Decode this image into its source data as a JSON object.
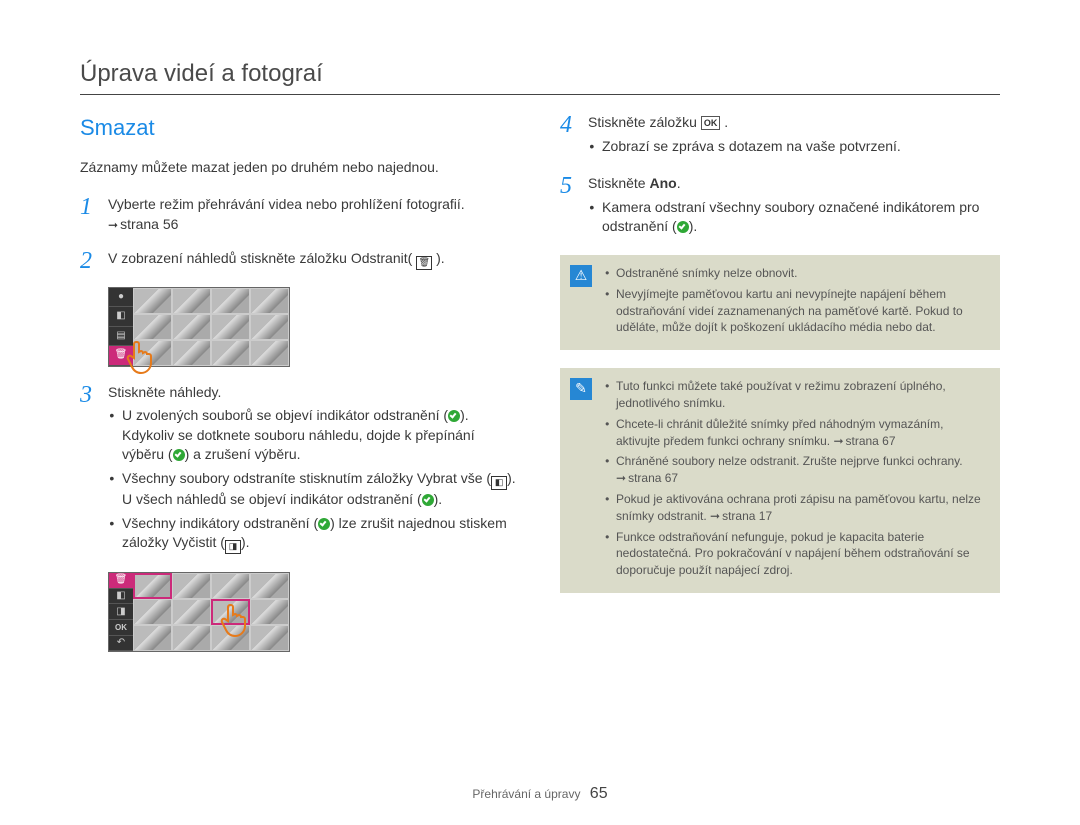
{
  "header": {
    "title": "Úprava videí a fotograí"
  },
  "section": {
    "title": "Smazat"
  },
  "intro": "Záznamy můžete mazat jeden po druhém nebo najednou.",
  "steps": {
    "s1": {
      "num": "1",
      "text": "Vyberte režim přehrávání videa nebo prohlížení fotografií.",
      "ref": "strana 56"
    },
    "s2": {
      "num": "2",
      "text_a": "V zobrazení náhledů stiskněte záložku Odstranit(",
      "text_b": ")."
    },
    "s3": {
      "num": "3",
      "text": "Stiskněte náhledy.",
      "b1a": "U zvolených souborů se objeví indikátor odstranění (",
      "b1b": "). Kdykoliv se dotknete souboru náhledu, dojde k přepínání výběru (",
      "b1c": ") a zrušení výběru.",
      "b2a": "Všechny soubory odstraníte stisknutím záložky Vybrat vše (",
      "b2b": "). U všech náhledů se objeví indikátor odstranění (",
      "b2c": ").",
      "b3a": "Všechny indikátory odstranění (",
      "b3b": ") lze zrušit najednou stiskem záložky Vyčistit (",
      "b3c": ")."
    },
    "s4": {
      "num": "4",
      "text_a": "Stiskněte záložku ",
      "text_b": ".",
      "b1": "Zobrazí se zpráva s dotazem na vaše potvrzení."
    },
    "s5": {
      "num": "5",
      "text_a": "Stiskněte ",
      "text_bold": "Ano",
      "text_b": ".",
      "b1a": "Kamera odstraní všechny soubory označené indikátorem pro odstranění (",
      "b1b": ")."
    }
  },
  "warn": {
    "w1": "Odstraněné snímky nelze obnovit.",
    "w2": "Nevyjímejte paměťovou kartu ani nevypínejte napájení během odstraňování videí zaznamenaných na paměťové kartě. Pokud to uděláte, může dojít k poškození ukládacího média nebo dat."
  },
  "info": {
    "i1": "Tuto funkci můžete také používat v režimu zobrazení úplného, jednotlivého snímku.",
    "i2a": "Chcete-li chránit důležité snímky před náhodným vymazáním, aktivujte předem funkci ochrany snímku. ",
    "i2ref": "strana 67",
    "i3a": "Chráněné soubory nelze odstranit. Zrušte nejprve funkci ochrany. ",
    "i3ref": "strana 67",
    "i4a": "Pokud je aktivována ochrana proti zápisu na paměťovou kartu, nelze snímky odstranit. ",
    "i4ref": "strana 17",
    "i5": "Funkce odstraňování nefunguje, pokud je kapacita baterie nedostatečná. Pro pokračování v napájení během odstraňování se doporučuje použít napájecí zdroj."
  },
  "icons": {
    "ok": "OK",
    "trash": "🗑",
    "selectall": "◧",
    "clear": "◨",
    "warn": "⚠",
    "pencil": "✎"
  },
  "footer": {
    "section": "Přehrávání a úpravy",
    "page": "65"
  }
}
